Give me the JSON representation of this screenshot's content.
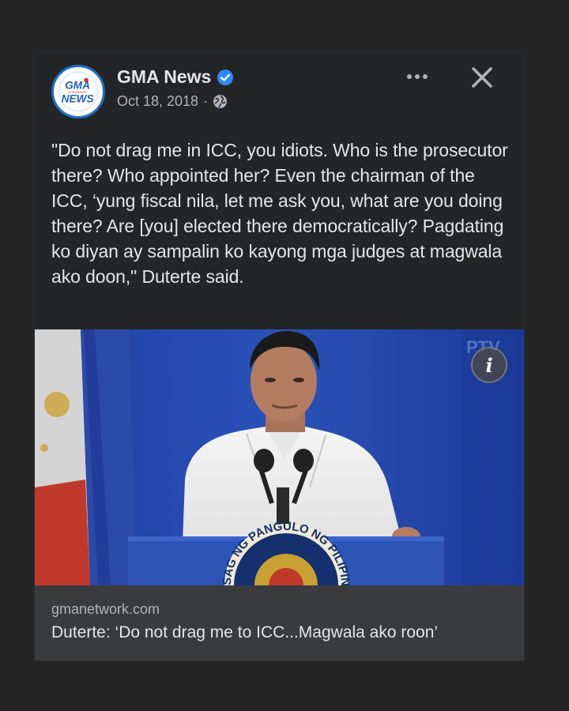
{
  "post": {
    "page_name": "GMA News",
    "date": "Oct 18, 2018",
    "separator": "·",
    "text": "\"Do not drag me in ICC, you idiots. Who is the prosecutor there? Who appointed her? Even the chairman of the ICC, ‘yung fiscal nila, let me ask you, what are you doing there? Are [you] elected there democratically? Pagdating ko diyan ay sampalin ko kayong mga judges at magwala ako doon,\" Duterte said.",
    "icons": {
      "verified": "verified-badge-icon",
      "audience": "globe-icon",
      "more": "more-options-icon",
      "close": "close-icon",
      "info": "info-icon"
    }
  },
  "avatar": {
    "logo_top": "GMA",
    "logo_small": "INTEGRATED",
    "logo_bottom": "NEWS"
  },
  "media": {
    "info_label": "i",
    "channel_bug": "PTV",
    "seal_text": "SAG NG PANGULO NG PILIPINAS"
  },
  "link": {
    "domain": "gmanetwork.com",
    "title": "Duterte: ‘Do not drag me to ICC...Magwala ako roon’"
  },
  "colors": {
    "background": "#252526",
    "card": "#242526",
    "link_bg": "#3a3b3c",
    "primary_text": "#e4e6eb",
    "secondary_text": "#b0b3b8",
    "verified": "#2d88ff"
  }
}
